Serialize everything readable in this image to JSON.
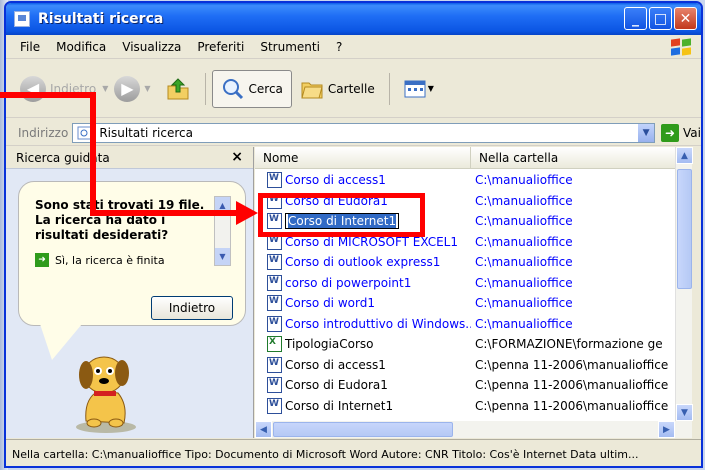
{
  "window": {
    "title": "Risultati ricerca"
  },
  "menu": [
    "File",
    "Modifica",
    "Visualizza",
    "Preferiti",
    "Strumenti",
    "?"
  ],
  "toolbar": {
    "back_label": "Indietro",
    "search_label": "Cerca",
    "folders_label": "Cartelle"
  },
  "address": {
    "label": "Indirizzo",
    "value": "Risultati ricerca",
    "go_label": "Vai"
  },
  "left_pane": {
    "header": "Ricerca guidata",
    "close": "×",
    "message": "Sono stati trovati 19 file. La ricerca ha dato i risultati desiderati?",
    "option_1": "Sì, la ricerca è finita",
    "back_button": "Indietro"
  },
  "list": {
    "columns": [
      "Nome",
      "Nella cartella"
    ],
    "rows": [
      {
        "name": "Corso di access1",
        "folder": "C:\\manualioffice",
        "icon": "word-doc-icon",
        "color": "blue"
      },
      {
        "name": "Corso di Eudora1",
        "folder": "C:\\manualioffice",
        "icon": "word-doc-icon",
        "color": "blue"
      },
      {
        "name": "Corso di Internet1",
        "folder": "C:\\manualioffice",
        "icon": "word-doc-icon",
        "color": "blue",
        "selected": true
      },
      {
        "name": "Corso di MICROSOFT EXCEL1",
        "folder": "C:\\manualioffice",
        "icon": "word-doc-icon",
        "color": "blue"
      },
      {
        "name": "Corso di outlook express1",
        "folder": "C:\\manualioffice",
        "icon": "word-doc-icon",
        "color": "blue"
      },
      {
        "name": "corso di powerpoint1",
        "folder": "C:\\manualioffice",
        "icon": "word-doc-icon",
        "color": "blue"
      },
      {
        "name": "Corso di word1",
        "folder": "C:\\manualioffice",
        "icon": "word-doc-icon",
        "color": "blue"
      },
      {
        "name": "Corso introduttivo di Windows...",
        "folder": "C:\\manualioffice",
        "icon": "word-doc-icon",
        "color": "blue"
      },
      {
        "name": "TipologiaCorso",
        "folder": "C:\\FORMAZIONE\\formazione ge",
        "icon": "excel-doc-icon",
        "color": "black"
      },
      {
        "name": "Corso di access1",
        "folder": "C:\\penna 11-2006\\manualioffice",
        "icon": "word-doc-icon",
        "color": "black"
      },
      {
        "name": "Corso di Eudora1",
        "folder": "C:\\penna 11-2006\\manualioffice",
        "icon": "word-doc-icon",
        "color": "black"
      },
      {
        "name": "Corso di Internet1",
        "folder": "C:\\penna 11-2006\\manualioffice",
        "icon": "word-doc-icon",
        "color": "black"
      }
    ]
  },
  "status": "Nella cartella: C:\\manualioffice Tipo: Documento di Microsoft Word Autore: CNR Titolo: Cos'è Internet Data ultim...",
  "colors": {
    "title_bar": "#0a5de7",
    "annotation": "#ff0000",
    "link": "#0000ff",
    "selection": "#316ac5"
  }
}
